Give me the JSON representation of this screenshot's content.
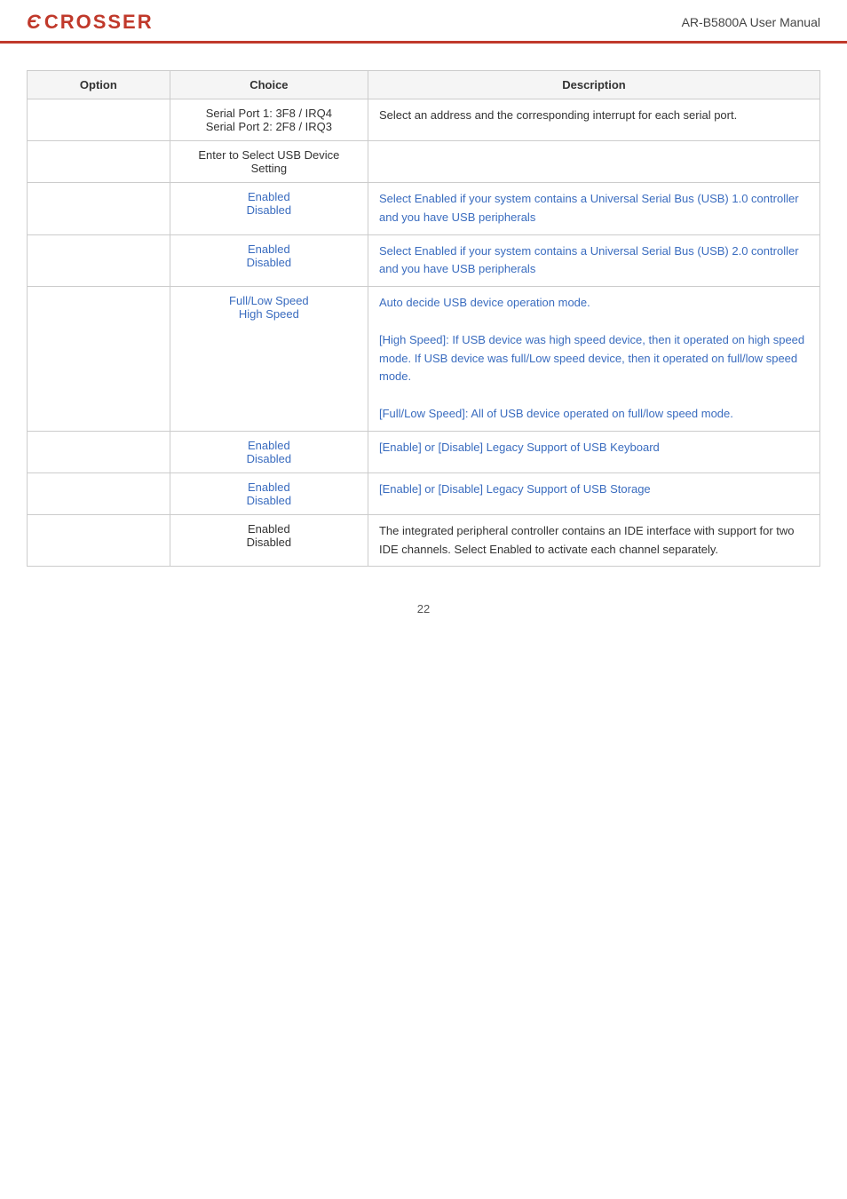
{
  "header": {
    "logo_symbol": "Ɛ",
    "logo_text": "CROSSER",
    "title": "AR-B5800A User Manual"
  },
  "table": {
    "columns": [
      "Option",
      "Choice",
      "Description"
    ],
    "rows": [
      {
        "option": "",
        "choices": [
          "Serial Port 1: 3F8 / IRQ4",
          "Serial Port 2: 2F8 / IRQ3"
        ],
        "description": "Select an address and the corresponding interrupt for each serial port.",
        "desc_color": "black"
      },
      {
        "option": "",
        "choices": [
          "Enter to Select USB Device Setting"
        ],
        "description": "",
        "desc_color": "black"
      },
      {
        "option": "",
        "choices": [
          "Enabled",
          "Disabled"
        ],
        "description": "Select Enabled if your system contains a Universal Serial Bus (USB) 1.0 controller and you have USB peripherals",
        "desc_color": "blue"
      },
      {
        "option": "",
        "choices": [
          "Enabled",
          "Disabled"
        ],
        "description": "Select Enabled if your system contains a Universal Serial Bus (USB) 2.0 controller and you have USB peripherals",
        "desc_color": "blue"
      },
      {
        "option": "",
        "choices": [
          "Full/Low Speed",
          "High Speed"
        ],
        "description": "Auto decide USB device operation mode.\n[High Speed]: If USB device was high speed device, then it operated on high speed mode. If USB device was full/Low speed device, then it operated on full/low speed mode.\n[Full/Low Speed]: All of USB device operated on full/low speed mode.",
        "desc_color": "blue"
      },
      {
        "option": "",
        "choices": [
          "Enabled",
          "Disabled"
        ],
        "description": "[Enable] or [Disable] Legacy Support of USB Keyboard",
        "desc_color": "blue"
      },
      {
        "option": "",
        "choices": [
          "Enabled",
          "Disabled"
        ],
        "description": "[Enable] or [Disable] Legacy Support of USB Storage",
        "desc_color": "blue"
      },
      {
        "option": "",
        "choices": [
          "Enabled",
          "Disabled"
        ],
        "description": "The integrated peripheral controller contains an IDE interface with support for two IDE channels. Select Enabled to activate each channel separately.",
        "desc_color": "black"
      }
    ]
  },
  "footer": {
    "page_number": "22"
  }
}
